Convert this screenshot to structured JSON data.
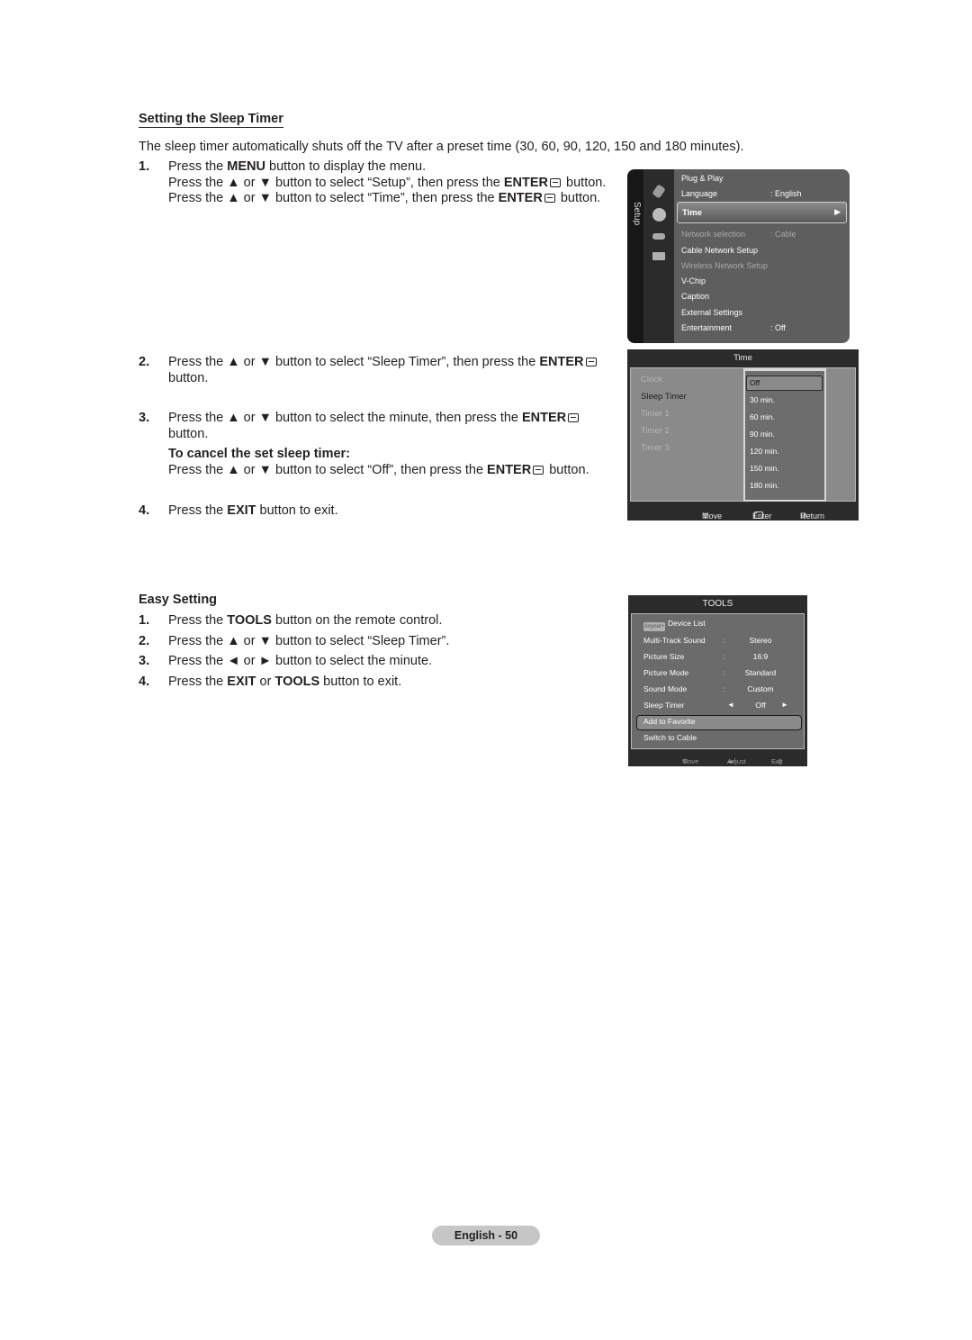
{
  "section1": {
    "heading": "Setting the Sleep Timer",
    "intro": "The sleep timer automatically shuts off the TV after a preset time (30, 60, 90, 120, 150 and 180 minutes).",
    "steps": [
      {
        "num": "1.",
        "lines": [
          {
            "pre": "Press the ",
            "bold": "MENU",
            "post": " button to display the menu."
          },
          {
            "pre": "Press the ▲ or ▼ button to select “Setup”, then press the ",
            "bold": "ENTER",
            "post": " button."
          },
          {
            "pre": "Press the ▲ or ▼ button to select “Time”, then press the ",
            "bold": "ENTER",
            "post": " button."
          }
        ]
      },
      {
        "num": "2.",
        "lines": [
          {
            "pre": "Press the ▲ or ▼ button to select “Sleep Timer”, then press the ",
            "bold": "ENTER",
            "post": ""
          },
          {
            "pre": "button.",
            "bold": "",
            "post": ""
          }
        ]
      },
      {
        "num": "3.",
        "lines": [
          {
            "pre": "Press the ▲ or ▼ button to select the minute, then press the ",
            "bold": "ENTER",
            "post": ""
          },
          {
            "pre": "button.",
            "bold": "",
            "post": ""
          }
        ]
      },
      {
        "num": "4.",
        "lines": [
          {
            "pre": "Press the ",
            "bold": "EXIT",
            "post": " button to exit."
          }
        ]
      }
    ],
    "cancel_heading": "To cancel the set sleep timer:",
    "cancel_text": {
      "pre": "Press the ▲ or ▼ button to select “Off”, then press the ",
      "bold": "ENTER",
      "post": " button."
    }
  },
  "setup_menu": {
    "rail_label": "Setup",
    "icons": [
      "input-icon",
      "setup-gear-icon",
      "support-icon",
      "application-icon"
    ],
    "items": [
      {
        "label": "Plug & Play",
        "value": "",
        "dim": false
      },
      {
        "label": "Language",
        "value": ": English",
        "dim": false
      },
      {
        "label": "Time",
        "value": "",
        "dim": false,
        "selected": true
      },
      {
        "label": "Network selection",
        "value": ": Cable",
        "dim": true
      },
      {
        "label": "Cable Network Setup",
        "value": "",
        "dim": false
      },
      {
        "label": "Wireless Network Setup",
        "value": "",
        "dim": true
      },
      {
        "label": "V-Chip",
        "value": "",
        "dim": false
      },
      {
        "label": "Caption",
        "value": "",
        "dim": false
      },
      {
        "label": "External Settings",
        "value": "",
        "dim": false
      },
      {
        "label": "Entertainment",
        "value": ": Off",
        "dim": false
      }
    ],
    "selected_arrow": "▶"
  },
  "time_menu": {
    "title": "Time",
    "items": [
      {
        "label": "Clock",
        "active": false
      },
      {
        "label": "Sleep Timer",
        "active": true
      },
      {
        "label": "Timer 1",
        "active": false
      },
      {
        "label": "Timer 2",
        "active": false
      },
      {
        "label": "Timer 3",
        "active": false
      }
    ],
    "dropdown_options": [
      "Off",
      "30 min.",
      "60 min.",
      "90 min.",
      "120 min.",
      "150 min.",
      "180 min."
    ],
    "dropdown_selected": "Off",
    "footer": {
      "move": "Move",
      "enter": "Enter",
      "return": "Return"
    }
  },
  "section2": {
    "heading": "Easy Setting",
    "steps": [
      {
        "num": "1.",
        "pre": "Press the ",
        "bold": "TOOLS",
        "post": " button on the remote control.",
        "bold2": "",
        "post2": ""
      },
      {
        "num": "2.",
        "pre": "Press the ▲ or ▼ button to select “Sleep Timer”.",
        "bold": "",
        "post": "",
        "bold2": "",
        "post2": ""
      },
      {
        "num": "3.",
        "pre": "Press the ◄ or ► button to select the minute.",
        "bold": "",
        "post": "",
        "bold2": "",
        "post2": ""
      },
      {
        "num": "4.",
        "pre": "Press the ",
        "bold": "EXIT",
        "post": " or ",
        "bold2": "TOOLS",
        "post2": " button to exit."
      }
    ]
  },
  "tools_menu": {
    "title": "TOOLS",
    "anynet_label": "Anynet+",
    "rows": [
      {
        "label": "Device List",
        "value": ""
      },
      {
        "label": "Multi-Track Sound",
        "value": "Stereo"
      },
      {
        "label": "Picture Size",
        "value": "16:9"
      },
      {
        "label": "Picture Mode",
        "value": "Standard"
      },
      {
        "label": "Sound Mode",
        "value": "Custom"
      },
      {
        "label": "Sleep Timer",
        "value": "Off",
        "selected": true
      },
      {
        "label": "Add to Favorite",
        "value": ""
      },
      {
        "label": "Switch to Cable",
        "value": ""
      }
    ],
    "footer": {
      "move": "Move",
      "adjust": "Adjust",
      "exit": "Exit"
    }
  },
  "page_number": "English - 50"
}
